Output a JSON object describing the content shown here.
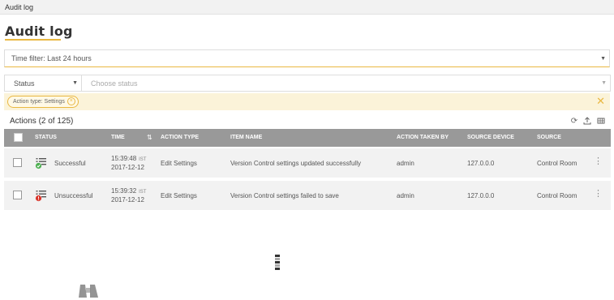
{
  "window": {
    "title": "Audit log"
  },
  "page": {
    "title": "Audit log"
  },
  "time_filter": {
    "label": "Time filter: Last 24 hours"
  },
  "status_filter": {
    "field": "Status",
    "placeholder": "Choose status"
  },
  "active_filters": [
    {
      "label": "Action type: Settings"
    }
  ],
  "actions": {
    "count_label": "Actions (2 of 125)"
  },
  "table": {
    "columns": [
      "STATUS",
      "TIME",
      "ACTION TYPE",
      "ITEM NAME",
      "ACTION TAKEN BY",
      "SOURCE DEVICE",
      "SOURCE"
    ],
    "rows": [
      {
        "status": "Successful",
        "status_icon": "list-success-icon",
        "time": "15:39:48",
        "tz": "IST",
        "date": "2017-12-12",
        "action_type": "Edit Settings",
        "item_name": "Version Control settings updated successfully",
        "taken_by": "admin",
        "source_device": "127.0.0.0",
        "source": "Control Room"
      },
      {
        "status": "Unsuccessful",
        "status_icon": "list-error-icon",
        "time": "15:39:32",
        "tz": "IST",
        "date": "2017-12-12",
        "action_type": "Edit Settings",
        "item_name": "Version Control settings failed to save",
        "taken_by": "admin",
        "source_device": "127.0.0.0",
        "source": "Control Room"
      }
    ]
  },
  "colors": {
    "accent": "#e9b842",
    "header": "#999999",
    "success": "#4caf50",
    "error": "#d9352b"
  }
}
